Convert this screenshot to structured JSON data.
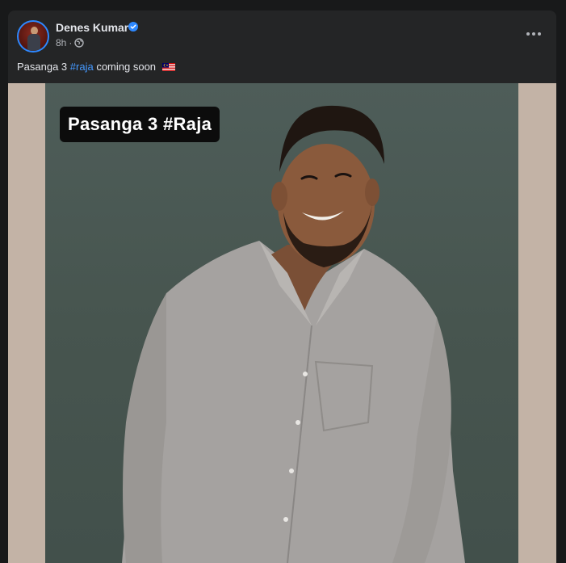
{
  "post": {
    "author": "Denes Kumar",
    "verified": true,
    "timestamp": "8h",
    "separator": "·",
    "privacy_icon": "globe-icon",
    "caption_before": "Pasanga 3 ",
    "caption_hashtag": "#raja",
    "caption_after": " coming soon",
    "caption_flag": "malaysia-flag-icon",
    "more_icon": "more-options-icon"
  },
  "media": {
    "overlay_text": "Pasanga 3 #Raja"
  },
  "colors": {
    "card_bg": "#242526",
    "page_bg": "#18191a",
    "name_text": "#e4e6eb",
    "meta_text": "#b0b3b8",
    "hashtag": "#4599ff",
    "verified": "#2d88ff"
  }
}
